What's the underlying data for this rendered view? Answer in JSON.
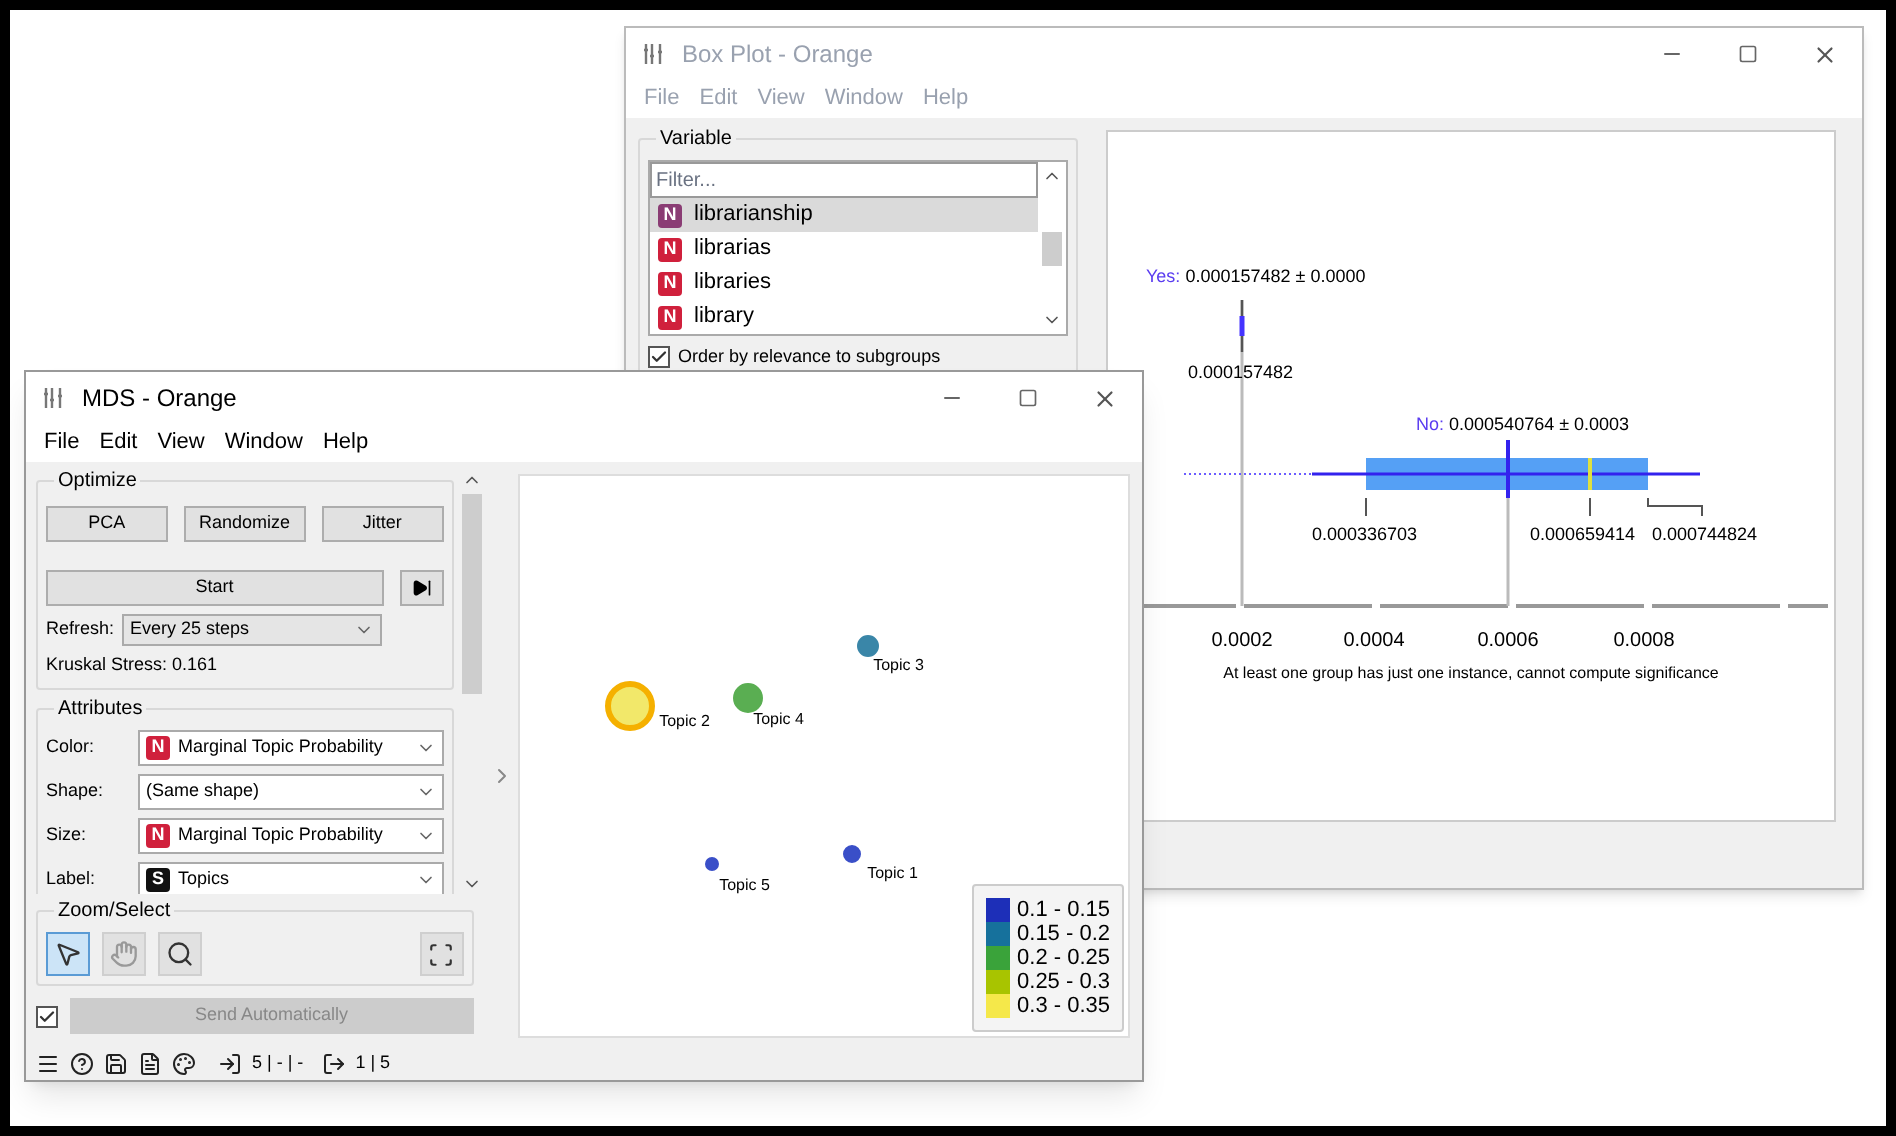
{
  "box_plot_window": {
    "title": "Box Plot - Orange",
    "menu": [
      "File",
      "Edit",
      "View",
      "Window",
      "Help"
    ],
    "variable": {
      "title": "Variable",
      "filter_placeholder": "Filter...",
      "items": [
        {
          "label": "librarianship",
          "badge": "N",
          "color": "#8a3c74",
          "selected": true
        },
        {
          "label": "librarias",
          "badge": "N",
          "color": "#d0203c",
          "selected": false
        },
        {
          "label": "libraries",
          "badge": "N",
          "color": "#d0203c",
          "selected": false
        },
        {
          "label": "library",
          "badge": "N",
          "color": "#d0203c",
          "selected": false
        }
      ],
      "order_checkbox": {
        "label": "Order by relevance to subgroups",
        "checked": true
      }
    },
    "chart": {
      "groups": [
        {
          "name": "Yes:",
          "summary": "0.000157482 ± 0.0000",
          "values": [
            "0.000157482"
          ]
        },
        {
          "name": "No:",
          "summary": "0.000540764 ± 0.0003",
          "values": [
            "0.000336703",
            "0.000659414",
            "0.000744824"
          ]
        }
      ],
      "axis_ticks": [
        "0.0002",
        "0.0004",
        "0.0006",
        "0.0008"
      ],
      "note": "At least one group has just one instance, cannot compute significance"
    }
  },
  "mds_window": {
    "title": "MDS - Orange",
    "menu": [
      "File",
      "Edit",
      "View",
      "Window",
      "Help"
    ],
    "optimize": {
      "title": "Optimize",
      "buttons": [
        "PCA",
        "Randomize",
        "Jitter"
      ],
      "start": "Start",
      "refresh_label": "Refresh:",
      "refresh_value": "Every 25 steps",
      "stress": "Kruskal Stress: 0.161"
    },
    "attributes": {
      "title": "Attributes",
      "rows": [
        {
          "label": "Color:",
          "value": "Marginal Topic Probability",
          "badge": "N",
          "color": "#d0203c"
        },
        {
          "label": "Shape:",
          "value": "(Same shape)"
        },
        {
          "label": "Size:",
          "value": "Marginal Topic Probability",
          "badge": "N",
          "color": "#d0203c"
        },
        {
          "label": "Label:",
          "value": "Topics",
          "badge": "S",
          "color": "#111111"
        }
      ]
    },
    "zoom_select": {
      "title": "Zoom/Select",
      "tools": [
        {
          "kind": "select",
          "selected": true
        },
        {
          "kind": "pan",
          "selected": false
        },
        {
          "kind": "zoom",
          "selected": false
        }
      ]
    },
    "send": {
      "label": "Send Automatically",
      "checked": true,
      "disabled": true
    },
    "points": [
      {
        "label": "Topic 1",
        "color": "#3a4fc8"
      },
      {
        "label": "Topic 2",
        "color": "#f2e86a"
      },
      {
        "label": "Topic 3",
        "color": "#3a86a8"
      },
      {
        "label": "Topic 4",
        "color": "#5aae52"
      },
      {
        "label": "Topic 5",
        "color": "#3a4fc8"
      }
    ],
    "legend": [
      {
        "label": "0.1 - 0.15",
        "color": "#1d2fb8"
      },
      {
        "label": "0.15 - 0.2",
        "color": "#16719c"
      },
      {
        "label": "0.2 - 0.25",
        "color": "#3aa33a"
      },
      {
        "label": "0.25 - 0.3",
        "color": "#a8c400"
      },
      {
        "label": "0.3 - 0.35",
        "color": "#f5e84a"
      }
    ],
    "status": {
      "input": "5 | - | -",
      "output": "1 | 5"
    }
  }
}
